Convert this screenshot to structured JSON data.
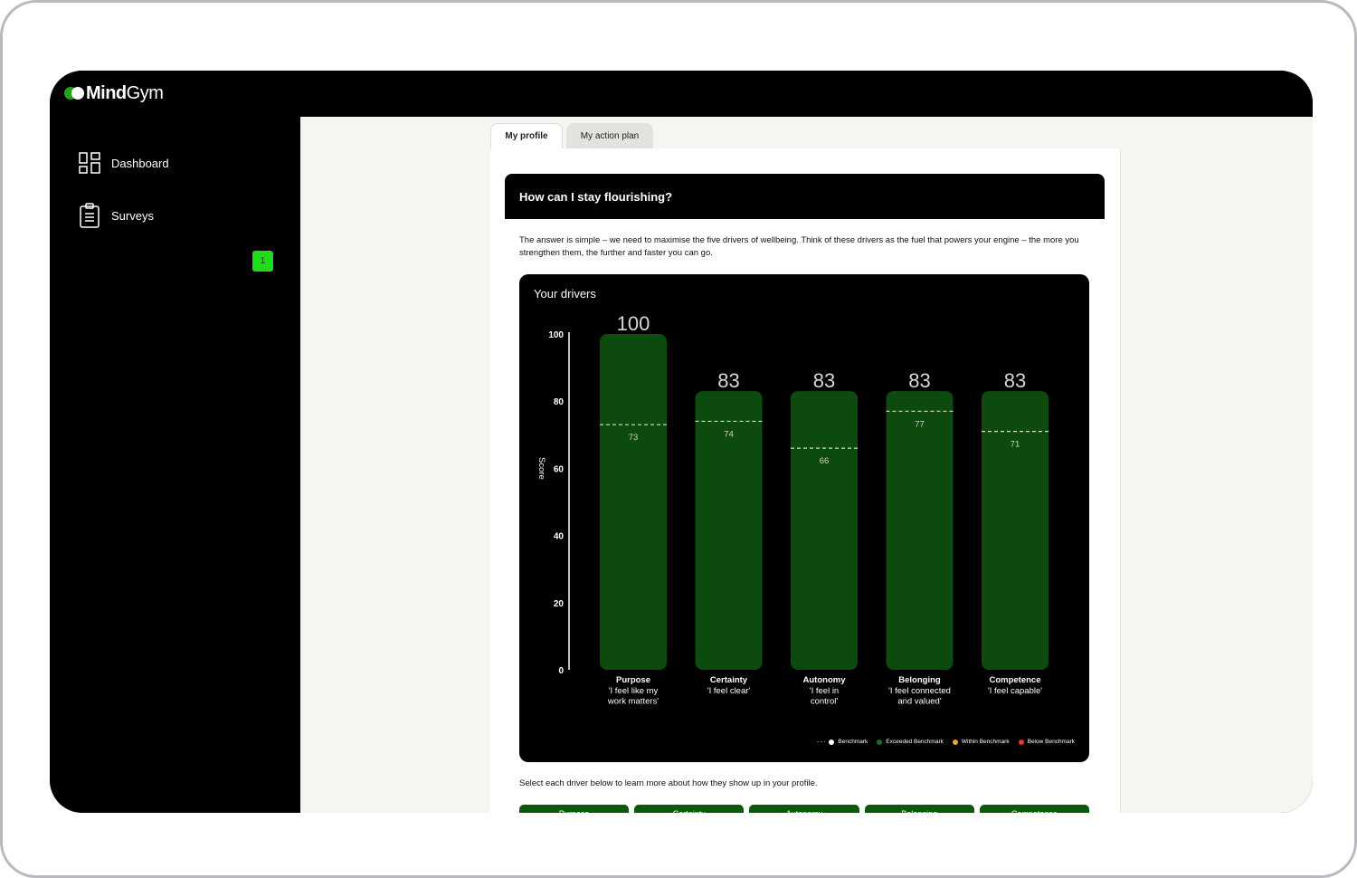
{
  "brand": {
    "name_bold": "Mind",
    "name_regular": "Gym"
  },
  "sidebar": {
    "items": [
      {
        "label": "Dashboard",
        "icon": "dashboard-icon"
      },
      {
        "label": "Surveys",
        "icon": "clipboard-icon",
        "badge": "1"
      }
    ]
  },
  "tabs": [
    {
      "label": "My profile",
      "active": true
    },
    {
      "label": "My action plan",
      "active": false
    }
  ],
  "section": {
    "heading": "How can I stay flourishing?",
    "intro": "The answer is simple – we need to maximise the five drivers of wellbeing. Think of these drivers as the fuel that powers your engine – the more you strengthen them, the further and faster you can go.",
    "select_prompt": "Select each driver below to learn more about how they show up in your profile."
  },
  "chart_data": {
    "type": "bar",
    "title": "Your drivers",
    "ylabel": "Score",
    "ylim": [
      0,
      100
    ],
    "yticks": [
      0,
      20,
      40,
      60,
      80,
      100
    ],
    "categories": [
      "Purpose",
      "Certainty",
      "Autonomy",
      "Belonging",
      "Competence"
    ],
    "subtitles": [
      "'I feel like my work matters'",
      "'I feel clear'",
      "'I feel in control'",
      "'I feel connected and valued'",
      "'I feel capable'"
    ],
    "values": [
      100,
      83,
      83,
      83,
      83
    ],
    "benchmarks": [
      73,
      74,
      66,
      77,
      71
    ],
    "bar_color": "#0d4a0d",
    "legend": [
      {
        "label": "Benchmark",
        "color": "#ffffff"
      },
      {
        "label": "Exceeded Benchmark",
        "color": "#1d6b1d"
      },
      {
        "label": "Within Benchmark",
        "color": "#f2a31a"
      },
      {
        "label": "Below Benchmark",
        "color": "#e8392b"
      }
    ]
  },
  "driver_buttons": [
    "Purpose",
    "Certainty",
    "Autonomy",
    "Belonging",
    "Competence"
  ],
  "colors": {
    "accent": "#1fdc1b",
    "dark_green": "#0b5a0b"
  }
}
